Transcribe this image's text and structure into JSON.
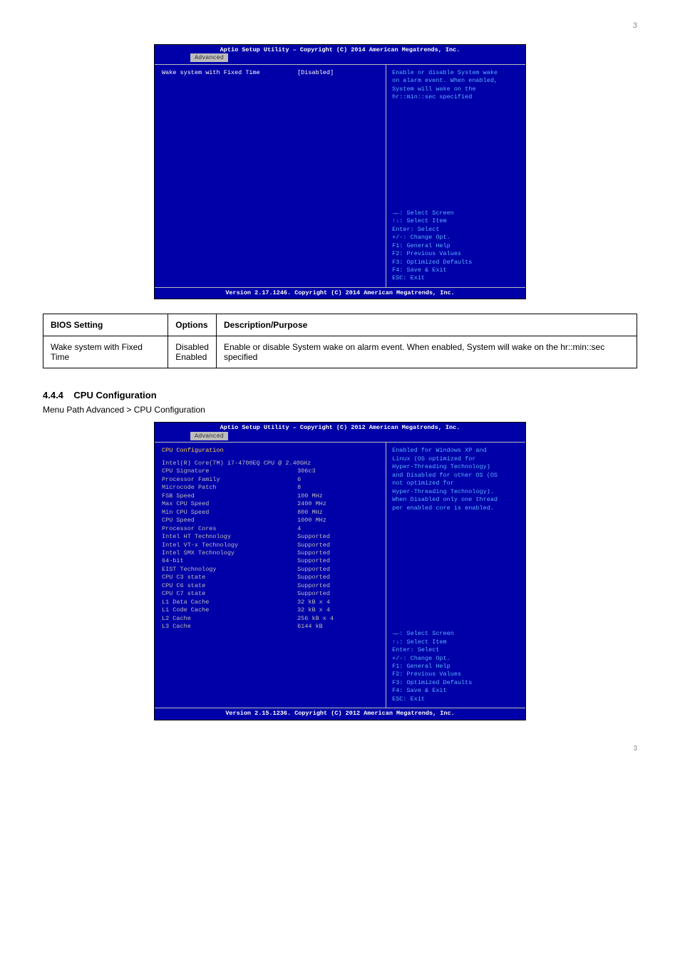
{
  "header_right": "3",
  "bios1": {
    "title": "Aptio Setup Utility – Copyright (C) 2014 American Megatrends, Inc.",
    "tab": "Advanced",
    "left_rows": [
      {
        "lbl": "Wake system with Fixed Time",
        "val": "[Disabled]",
        "hl": true
      }
    ],
    "help_top": "Enable or disable System wake\non alarm event. When enabled,\nSystem will wake on the\nhr::min::sec specified",
    "help_bottom": "→←: Select Screen\n↑↓: Select Item\nEnter: Select\n+/-: Change Opt.\nF1: General Help\nF2: Previous Values\nF3: Optimized Defaults\nF4: Save & Exit\nESC: Exit",
    "footer": "Version 2.17.1246. Copyright (C) 2014 American Megatrends, Inc."
  },
  "opt_table": {
    "h1": "BIOS Setting",
    "h2": "Options",
    "h3": "Description/Purpose",
    "r1c1": "Wake system with Fixed Time",
    "r1c2": "Disabled\nEnabled",
    "r1c3": "Enable or disable System wake on alarm event. When enabled, System will wake on the hr::min::sec specified"
  },
  "section": {
    "num": "4.4.4",
    "title": "CPU Configuration",
    "sub": "Menu Path     Advanced > CPU Configuration"
  },
  "bios2": {
    "title": "Aptio Setup Utility – Copyright (C) 2012 American Megatrends, Inc.",
    "tab": "Advanced",
    "left_header": "CPU Configuration",
    "left_rows": [
      {
        "lbl": "Intel(R) Core(TM) i7-4700EQ CPU @ 2.40GHz",
        "val": ""
      },
      {
        "lbl": "CPU Signature",
        "val": "306c3"
      },
      {
        "lbl": "Processor Family",
        "val": "6"
      },
      {
        "lbl": "Microcode Patch",
        "val": "8"
      },
      {
        "lbl": "FSB Speed",
        "val": "100 MHz"
      },
      {
        "lbl": "Max CPU Speed",
        "val": "2400 MHz"
      },
      {
        "lbl": "Min CPU Speed",
        "val": "800 MHz"
      },
      {
        "lbl": "CPU Speed",
        "val": "1000 MHz"
      },
      {
        "lbl": "Processor Cores",
        "val": "4"
      },
      {
        "lbl": "Intel HT Technology",
        "val": "Supported"
      },
      {
        "lbl": "Intel VT-x Technology",
        "val": "Supported"
      },
      {
        "lbl": "Intel SMX Technology",
        "val": "Supported"
      },
      {
        "lbl": "64-bit",
        "val": "Supported"
      },
      {
        "lbl": "EIST Technology",
        "val": "Supported"
      },
      {
        "lbl": "CPU C3 state",
        "val": "Supported"
      },
      {
        "lbl": "CPU C6 state",
        "val": "Supported"
      },
      {
        "lbl": "CPU C7 state",
        "val": "Supported"
      },
      {
        "lbl": "",
        "val": ""
      },
      {
        "lbl": "L1 Data Cache",
        "val": "32 kB x 4"
      },
      {
        "lbl": "L1 Code Cache",
        "val": "32 kB x 4"
      },
      {
        "lbl": "L2 Cache",
        "val": "256 kB x 4"
      },
      {
        "lbl": "L3 Cache",
        "val": "6144 kB"
      }
    ],
    "help_top": "Enabled for Windows XP and\nLinux (OS optimized for\nHyper-Threading Technology)\nand Disabled for other OS (OS\nnot optimized for\nHyper-Threading Technology).\nWhen Disabled only one thread\nper enabled core is enabled.",
    "help_bottom": "→←: Select Screen\n↑↓: Select Item\nEnter: Select\n+/-: Change Opt.\nF1: General Help\nF2: Previous Values\nF3: Optimized Defaults\nF4: Save & Exit\nESC: Exit",
    "footer": "Version 2.15.1236. Copyright (C) 2012 American Megatrends, Inc."
  },
  "page_footer": "3"
}
